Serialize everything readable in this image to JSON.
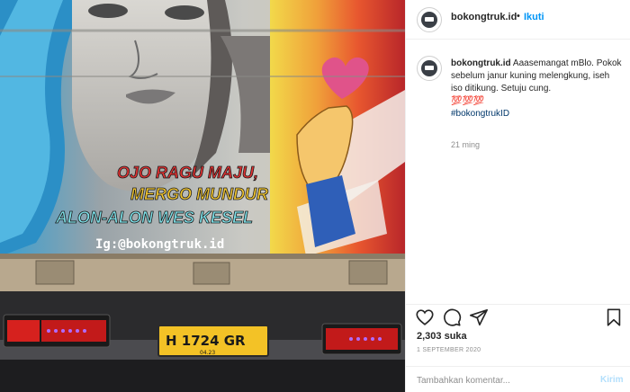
{
  "post": {
    "username": "bokongtruk.id",
    "follow_label": "Ikuti",
    "separator": "•",
    "caption": {
      "username": "bokongtruk.id",
      "text": "Aaasemangat mBlo. Pokok sebelum janur kuning melengkung, iseh iso ditikung. Setuju cung.",
      "emoji": "💯💯💯",
      "hashtag": "#bokongtrukID",
      "time_ago": "21 ming"
    },
    "likes": "2,303 suka",
    "date": "1 SEPTEMBER 2020",
    "comment": {
      "placeholder": "Tambahkan komentar...",
      "send_label": "Kirim"
    },
    "icons": {
      "like": "heart-icon",
      "comment": "comment-icon",
      "share": "share-icon",
      "save": "bookmark-icon"
    }
  },
  "photo": {
    "slogan_line1": "OJO RAGU MAJU,",
    "slogan_line2": "MERGO MUNDUR",
    "slogan_line3": "ALON-ALON WES KESEL",
    "ig_handle": "Ig:@bokongtruk.id",
    "plate": "H 1724 GR",
    "plate_expiry": "04.23"
  },
  "colors": {
    "link": "#0095f6",
    "hashtag": "#00376b",
    "muted": "#8e8e8e",
    "send_disabled": "#b2dffc"
  }
}
